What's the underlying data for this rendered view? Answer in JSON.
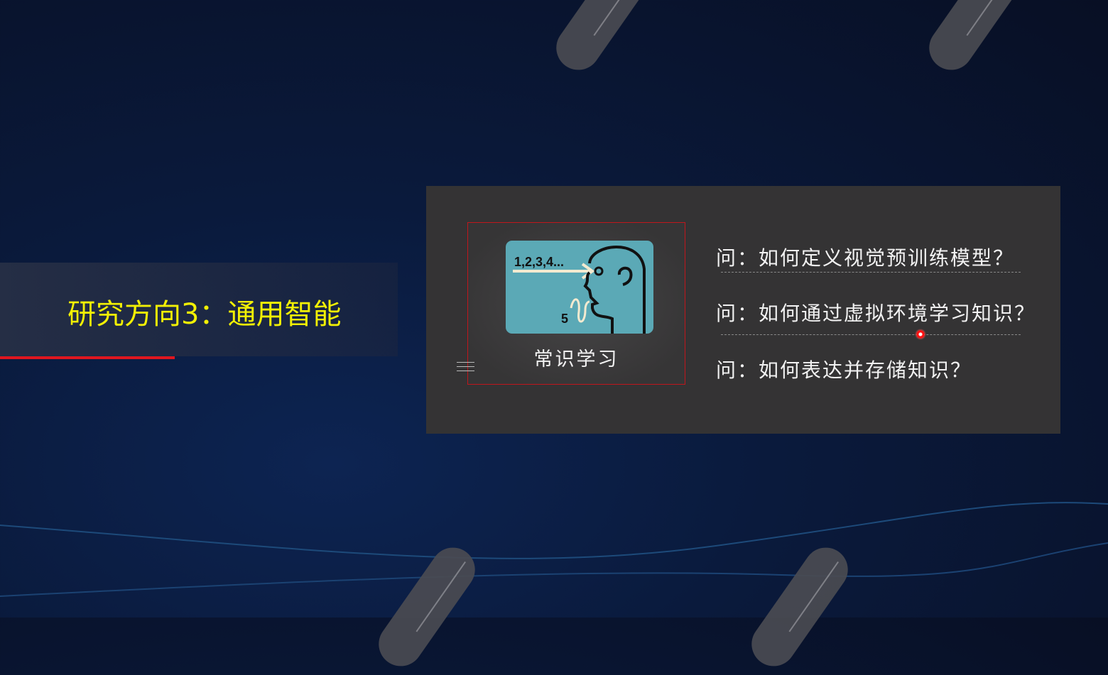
{
  "slide": {
    "title": "研究方向3：通用智能",
    "card": {
      "caption": "常识学习",
      "image": {
        "sequence_text": "1,2,3,4...",
        "answer_text": "5",
        "icon": "head-thinking-icon"
      }
    },
    "questions": [
      "问：如何定义视觉预训练模型？",
      "问：如何通过虚拟环境学习知识？",
      "问：如何表达并存储知识？"
    ]
  },
  "colors": {
    "title": "#f2f005",
    "accent_line": "#e0161f",
    "panel": "#343334",
    "image_bg": "#5ba9b6",
    "laser": "#ff1010"
  }
}
